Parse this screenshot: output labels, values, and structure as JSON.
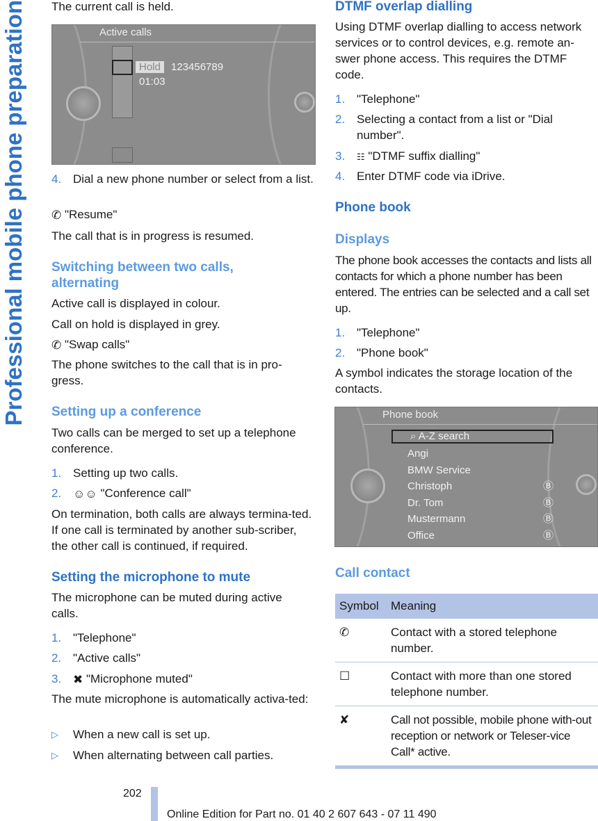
{
  "sidebar": {
    "title": "Professional mobile phone preparation"
  },
  "left": {
    "p_held": "The current call is held.",
    "screen1": {
      "title": "Active calls",
      "hold": "Hold",
      "number": "123456789",
      "time": "01:03"
    },
    "step4": {
      "n": "4.",
      "text": "Dial a new phone number or select from a list."
    },
    "resume": "\"Resume\"",
    "resume_desc": "The call that is in progress is resumed.",
    "h_switch": "Switching between two calls, alternating",
    "p_colour": "Active call is displayed in colour.",
    "p_grey": "Call on hold is displayed in grey.",
    "swap": "\"Swap calls\"",
    "swap_desc": "The phone switches to the call that is in pro-gress.",
    "h_conf": "Setting up a conference",
    "conf_desc": "Two calls can be merged to set up a telephone conference.",
    "conf_steps": [
      {
        "n": "1.",
        "text": "Setting up two calls."
      },
      {
        "n": "2.",
        "text": "\"Conference call\""
      }
    ],
    "conf_term": "On termination, both calls are always termina-ted. If one call is terminated by another sub-scriber, the other call is continued, if required.",
    "h_mute": "Setting the microphone to mute",
    "mute_desc": "The microphone can be muted during active calls.",
    "mute_steps": [
      {
        "n": "1.",
        "text": "\"Telephone\""
      },
      {
        "n": "2.",
        "text": "\"Active calls\""
      },
      {
        "n": "3.",
        "text": "\"Microphone muted\""
      }
    ],
    "mute_auto": "The mute microphone is automatically activa-ted:",
    "bullets": [
      "When a new call is set up.",
      "When alternating between call parties."
    ]
  },
  "right": {
    "h_dtmf": "DTMF overlap dialling",
    "dtmf_desc": "Using DTMF overlap dialling to access network services or to control devices, e.g. remote an-swer phone access. This requires the DTMF code.",
    "dtmf_steps": [
      {
        "n": "1.",
        "text": "\"Telephone\""
      },
      {
        "n": "2.",
        "text": "Selecting a contact from a list or \"Dial number\"."
      },
      {
        "n": "3.",
        "text": "\"DTMF suffix dialling\""
      },
      {
        "n": "4.",
        "text": "Enter DTMF code via iDrive."
      }
    ],
    "h_pb": "Phone book",
    "h_disp": "Displays",
    "disp_desc": "The phone book accesses the contacts and lists all contacts for which a phone number has been entered. The entries can be selected and a call set up.",
    "pb_steps": [
      {
        "n": "1.",
        "text": "\"Telephone\""
      },
      {
        "n": "2.",
        "text": "\"Phone book\""
      }
    ],
    "symbol_desc": "A symbol indicates the storage location of the contacts.",
    "screen2": {
      "title": "Phone book",
      "search": "A-Z search",
      "contacts": [
        {
          "name": "Angi",
          "bt": false
        },
        {
          "name": "BMW Service",
          "bt": false
        },
        {
          "name": "Christoph",
          "bt": true
        },
        {
          "name": "Dr. Tom",
          "bt": true
        },
        {
          "name": "Mustermann",
          "bt": true
        },
        {
          "name": "Office",
          "bt": true
        }
      ]
    },
    "h_cc": "Call contact",
    "table": {
      "headers": [
        "Symbol",
        "Meaning"
      ],
      "rows": [
        {
          "icon": "phone-icon",
          "text": "Contact with a stored telephone number."
        },
        {
          "icon": "multiple-numbers-icon",
          "text": "Contact with more than one stored telephone number."
        },
        {
          "icon": "no-call-icon",
          "text": "Call not possible, mobile phone with-out reception or network or Teleser-vice Call* active."
        }
      ]
    }
  },
  "footer": {
    "page": "202",
    "edition": "Online Edition for Part no. 01 40 2 607 643 - 07 11 490"
  },
  "colors": {
    "heading": "#2f72c4",
    "subheading": "#5c9ae0",
    "accent_bar": "#b3c3e5"
  }
}
